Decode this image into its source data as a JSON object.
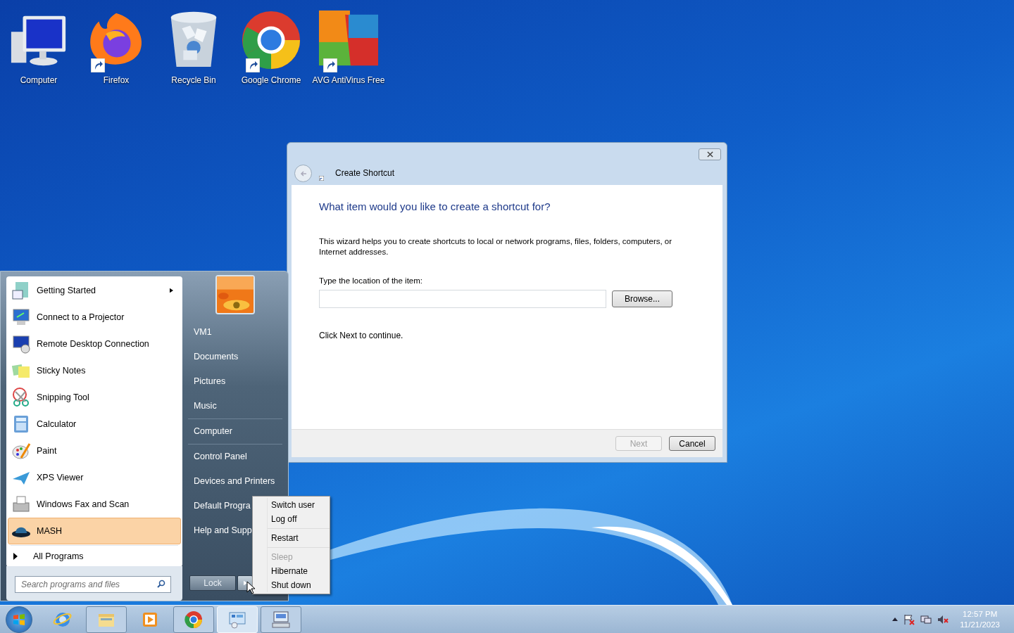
{
  "desktop_icons": [
    {
      "label": "Computer",
      "shortcut": false
    },
    {
      "label": "Firefox",
      "shortcut": true
    },
    {
      "label": "Recycle Bin",
      "shortcut": false
    },
    {
      "label": "Google Chrome",
      "shortcut": true
    },
    {
      "label": "AVG AntiVirus Free",
      "shortcut": true
    }
  ],
  "dialog": {
    "title": "Create Shortcut",
    "heading": "What item would you like to create a shortcut for?",
    "description": "This wizard helps you to create shortcuts to local or network programs, files, folders, computers, or Internet addresses.",
    "field_label": "Type the location of the item:",
    "browse_button": "Browse...",
    "hint": "Click Next to continue.",
    "buttons": [
      {
        "label": "Next",
        "disabled": true
      },
      {
        "label": "Cancel",
        "disabled": false
      }
    ]
  },
  "start_menu": {
    "programs": [
      {
        "label": "Getting Started",
        "has_submenu": true,
        "selected": false
      },
      {
        "label": "Connect to a Projector",
        "has_submenu": false,
        "selected": false
      },
      {
        "label": "Remote Desktop Connection",
        "has_submenu": false,
        "selected": false
      },
      {
        "label": "Sticky Notes",
        "has_submenu": false,
        "selected": false
      },
      {
        "label": "Snipping Tool",
        "has_submenu": false,
        "selected": false
      },
      {
        "label": "Calculator",
        "has_submenu": false,
        "selected": false
      },
      {
        "label": "Paint",
        "has_submenu": false,
        "selected": false
      },
      {
        "label": "XPS Viewer",
        "has_submenu": false,
        "selected": false
      },
      {
        "label": "Windows Fax and Scan",
        "has_submenu": false,
        "selected": false
      },
      {
        "label": "MASH",
        "has_submenu": false,
        "selected": true
      }
    ],
    "all_programs": "All Programs",
    "search": {
      "placeholder": "Search programs and files"
    },
    "places": [
      [
        "VM1",
        "Documents",
        "Pictures",
        "Music"
      ],
      [
        "Computer"
      ],
      [
        "Control Panel",
        "Devices and Printers",
        "Default Progra",
        "Help and Supp"
      ]
    ],
    "lock_button": "Lock"
  },
  "power_menu": [
    [
      {
        "label": "Switch user",
        "disabled": false
      },
      {
        "label": "Log off",
        "disabled": false
      }
    ],
    [
      {
        "label": "Restart",
        "disabled": false
      }
    ],
    [
      {
        "label": "Sleep",
        "disabled": true
      },
      {
        "label": "Hibernate",
        "disabled": false
      },
      {
        "label": "Shut down",
        "disabled": false
      }
    ]
  ],
  "taskbar": {
    "apps": [
      {
        "running": false,
        "selected": false
      },
      {
        "running": true,
        "selected": false
      },
      {
        "running": false,
        "selected": false
      },
      {
        "running": true,
        "selected": false
      },
      {
        "running": true,
        "selected": true
      },
      {
        "running": true,
        "selected": false
      }
    ],
    "time": "12:57 PM",
    "date": "11/21/2023"
  }
}
